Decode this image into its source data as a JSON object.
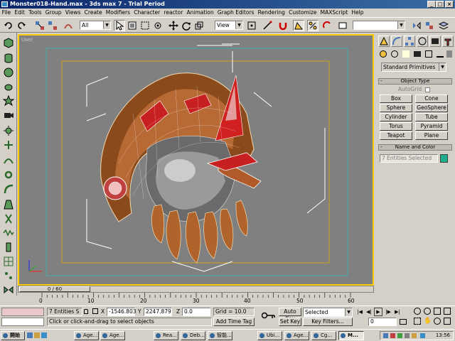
{
  "window": {
    "title": "Monster018-Hand.max - 3ds max 7  - Trial Period",
    "buttons": {
      "minimize": "_",
      "maximize": "□",
      "close": "×"
    }
  },
  "menu": [
    "File",
    "Edit",
    "Tools",
    "Group",
    "Views",
    "Create",
    "Modifiers",
    "Character",
    "reactor",
    "Animation",
    "Graph Editors",
    "Rendering",
    "Customize",
    "MAXScript",
    "Help"
  ],
  "toolbar": {
    "selection_filter": "All",
    "reference_coord": "View",
    "named_selection": ""
  },
  "viewport": {
    "label": "User",
    "accent_color": "#ffcc00"
  },
  "command_panel": {
    "primitive_type": "Standard Primitives",
    "object_type_header": "Object Type",
    "autogrid_label": "AutoGrid",
    "object_buttons": [
      "Box",
      "Cone",
      "Sphere",
      "GeoSphere",
      "Cylinder",
      "Tube",
      "Torus",
      "Pyramid",
      "Teapot",
      "Plane"
    ],
    "name_color_header": "Name and Color",
    "name_value": "7 Entities Selected",
    "swatch_color": "#1fae8c",
    "minus_sign": "-"
  },
  "timeline": {
    "slider_label": "0 / 60",
    "ticks": [
      "0",
      "10",
      "20",
      "30",
      "40",
      "50",
      "60"
    ]
  },
  "status": {
    "selection_count": "7 Entities S",
    "prompt": "Click or click-and-drag to select objects",
    "x_label": "X",
    "x_value": "-1546.803",
    "y_label": "Y",
    "y_value": "2247.879",
    "z_label": "Z",
    "z_value": "0.0",
    "grid": "Grid = 10.0",
    "add_time_tag": "Add Time Tag",
    "auto_key": "Auto Key",
    "auto_key_mode": "Selected",
    "set_key": "Set Key",
    "key_filters": "Key Filters...",
    "frame": "0"
  },
  "taskbar": {
    "start": "開始",
    "tasks": [
      "Age...",
      "Age...",
      "Rea...",
      "Deb...",
      "智能...",
      "Ubi...",
      "Age...",
      "Cg...",
      "M..."
    ],
    "clock": "13:56"
  }
}
